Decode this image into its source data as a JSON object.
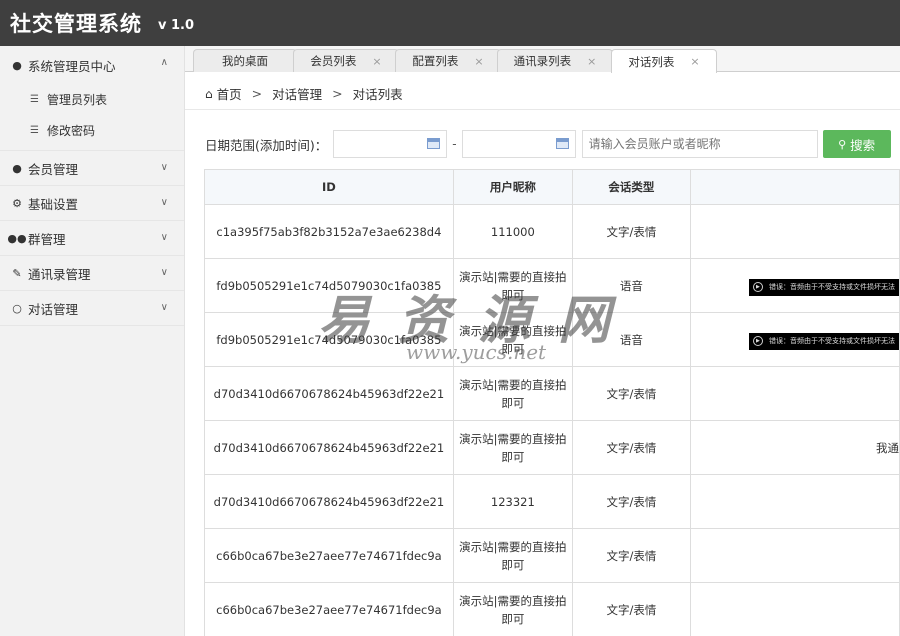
{
  "header": {
    "title": "社交管理系统",
    "version": "v 1.0"
  },
  "sidebar": {
    "items": [
      {
        "label": "系统管理员中心",
        "icon": "user-icon",
        "open": true,
        "children": [
          {
            "label": "管理员列表"
          },
          {
            "label": "修改密码"
          }
        ]
      },
      {
        "label": "会员管理",
        "icon": "user-icon"
      },
      {
        "label": "基础设置",
        "icon": "gear-icon"
      },
      {
        "label": "群管理",
        "icon": "group-icon"
      },
      {
        "label": "通讯录管理",
        "icon": "edit-icon"
      },
      {
        "label": "对话管理",
        "icon": "chat-icon"
      }
    ]
  },
  "tabs": [
    {
      "label": "我的桌面",
      "closable": false
    },
    {
      "label": "会员列表",
      "closable": true
    },
    {
      "label": "配置列表",
      "closable": true
    },
    {
      "label": "通讯录列表",
      "closable": true
    },
    {
      "label": "对话列表",
      "closable": true,
      "active": true
    }
  ],
  "tab_close_glyph": "×",
  "breadcrumb": {
    "home": "首页",
    "separator": ">",
    "items": [
      "对话管理",
      "对话列表"
    ]
  },
  "filter": {
    "label": "日期范围(添加时间)：",
    "dash": "-",
    "search_placeholder": "请输入会员账户或者昵称",
    "search_button": "搜索"
  },
  "table": {
    "columns": [
      "ID",
      "用户昵称",
      "会话类型",
      ""
    ],
    "rows": [
      {
        "id": "c1a395f75ab3f82b3152a7e3ae6238d4",
        "nickname": [
          "111000"
        ],
        "type": "文字/表情",
        "content": ""
      },
      {
        "id": "fd9b0505291e1c74d5079030c1fa0385",
        "nickname": [
          "演示站|需要的直接拍",
          "即可"
        ],
        "type": "语音",
        "content": "错误：音频由于不受支持或文件损坏无法"
      },
      {
        "id": "fd9b0505291e1c74d5079030c1fa0385",
        "nickname": [
          "演示站|需要的直接拍",
          "即可"
        ],
        "type": "语音",
        "content": "错误：音频由于不受支持或文件损坏无法"
      },
      {
        "id": "d70d3410d6670678624b45963df22e21",
        "nickname": [
          "演示站|需要的直接拍",
          "即可"
        ],
        "type": "文字/表情",
        "content": ""
      },
      {
        "id": "d70d3410d6670678624b45963df22e21",
        "nickname": [
          "演示站|需要的直接拍",
          "即可"
        ],
        "type": "文字/表情",
        "content": "我通"
      },
      {
        "id": "d70d3410d6670678624b45963df22e21",
        "nickname": [
          "123321"
        ],
        "type": "文字/表情",
        "content": ""
      },
      {
        "id": "c66b0ca67be3e27aee77e74671fdec9a",
        "nickname": [
          "演示站|需要的直接拍",
          "即可"
        ],
        "type": "文字/表情",
        "content": ""
      },
      {
        "id": "c66b0ca67be3e27aee77e74671fdec9a",
        "nickname": [
          "演示站|需要的直接拍",
          "即可"
        ],
        "type": "文字/表情",
        "content": ""
      }
    ]
  },
  "watermark": {
    "text": "易资源网",
    "url": "www.yucs.net"
  },
  "colors": {
    "header_bg": "#3f3f3f",
    "sidebar_bg": "#f2f2f2",
    "search_button": "#5cb85c",
    "table_header_bg": "#f5f8fb"
  }
}
